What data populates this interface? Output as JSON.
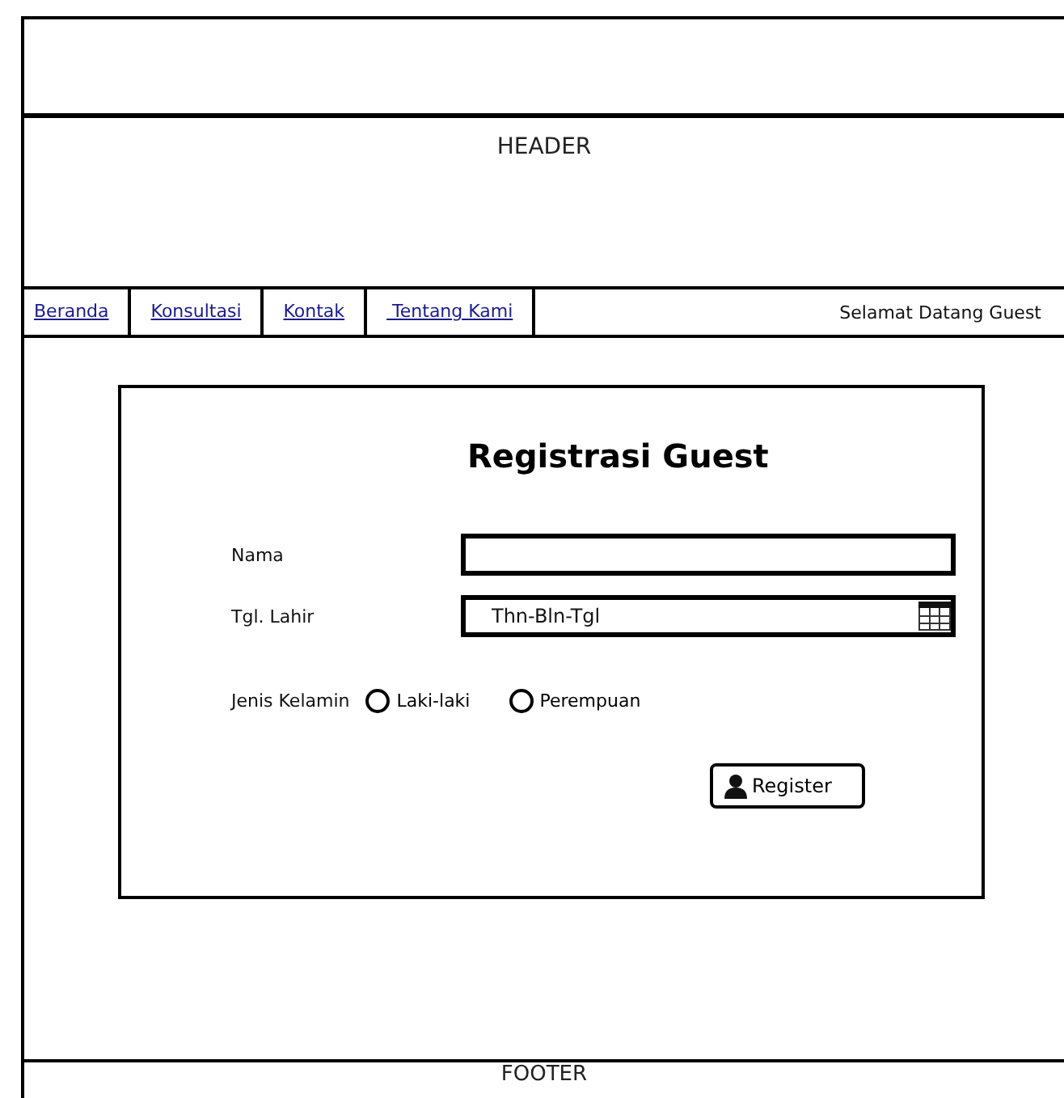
{
  "header": {
    "label": "HEADER"
  },
  "nav": {
    "links": [
      {
        "label": "Beranda"
      },
      {
        "label": "Konsultasi"
      },
      {
        "label": "Kontak"
      },
      {
        "label": " Tentang Kami"
      }
    ],
    "greeting": "Selamat Datang Guest"
  },
  "form": {
    "title": "Registrasi Guest",
    "fields": [
      {
        "kind": "text",
        "label": "Nama"
      },
      {
        "kind": "date",
        "label": "Tgl. Lahir",
        "placeholder": "Thn-Bln-Tgl"
      }
    ],
    "gender": {
      "label": "Jenis Kelamin",
      "options": [
        {
          "label": "Laki-laki",
          "selected": false
        },
        {
          "label": "Perempuan",
          "selected": false
        }
      ]
    },
    "button": "Register"
  },
  "footer": {
    "label": "FOOTER"
  }
}
